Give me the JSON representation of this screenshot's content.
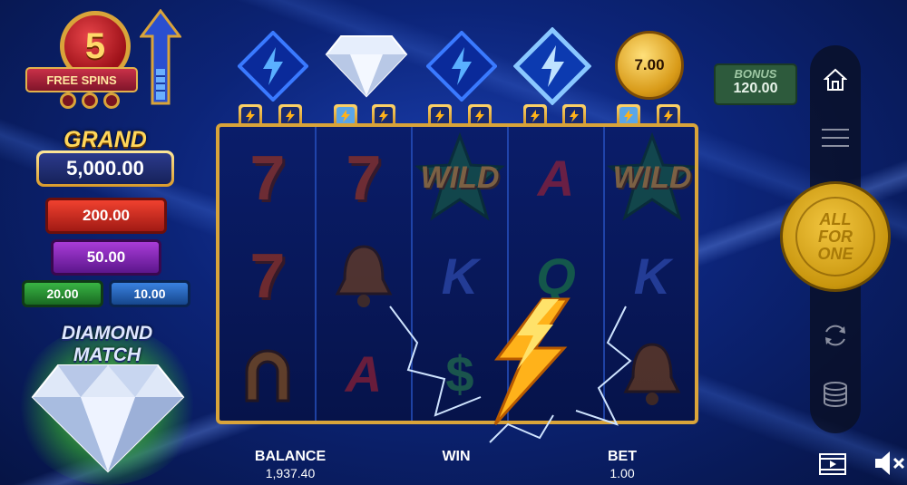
{
  "free_spins": {
    "count": "5",
    "label": "FREE SPINS"
  },
  "jackpots": {
    "grand_label": "GRAND",
    "grand_value": "5,000.00",
    "major": "200.00",
    "minor": "50.00",
    "mini": "20.00",
    "micro": "10.00"
  },
  "diamond_match": {
    "line1": "DIAMOND",
    "line2": "MATCH"
  },
  "top_row": {
    "symbols": [
      "lightning-diamond",
      "diamond",
      "lightning-diamond",
      "lightning-diamond-glow",
      "coin"
    ],
    "coin_value": "7.00"
  },
  "bonus": {
    "label": "BONUS",
    "value": "120.00"
  },
  "collector_pips": [
    false,
    false,
    true,
    false,
    false,
    false,
    false,
    false,
    true,
    false
  ],
  "reels": [
    [
      "7",
      "7",
      "horseshoe"
    ],
    [
      "7",
      "bell",
      "A"
    ],
    [
      "WILD",
      "K",
      "$"
    ],
    [
      "A",
      "Q",
      "bolt"
    ],
    [
      "WILD",
      "K",
      "bell"
    ]
  ],
  "spin_button": {
    "line1": "ALL",
    "line2": "FOR",
    "line3": "ONE"
  },
  "bottom": {
    "balance_label": "BALANCE",
    "balance_value": "1,937.40",
    "win_label": "WIN",
    "win_value": "",
    "bet_label": "BET",
    "bet_value": "1.00"
  },
  "colors": {
    "frame_gold": "#d9a43a",
    "background": "#0c2478",
    "accent_blue": "#2a55c8"
  }
}
